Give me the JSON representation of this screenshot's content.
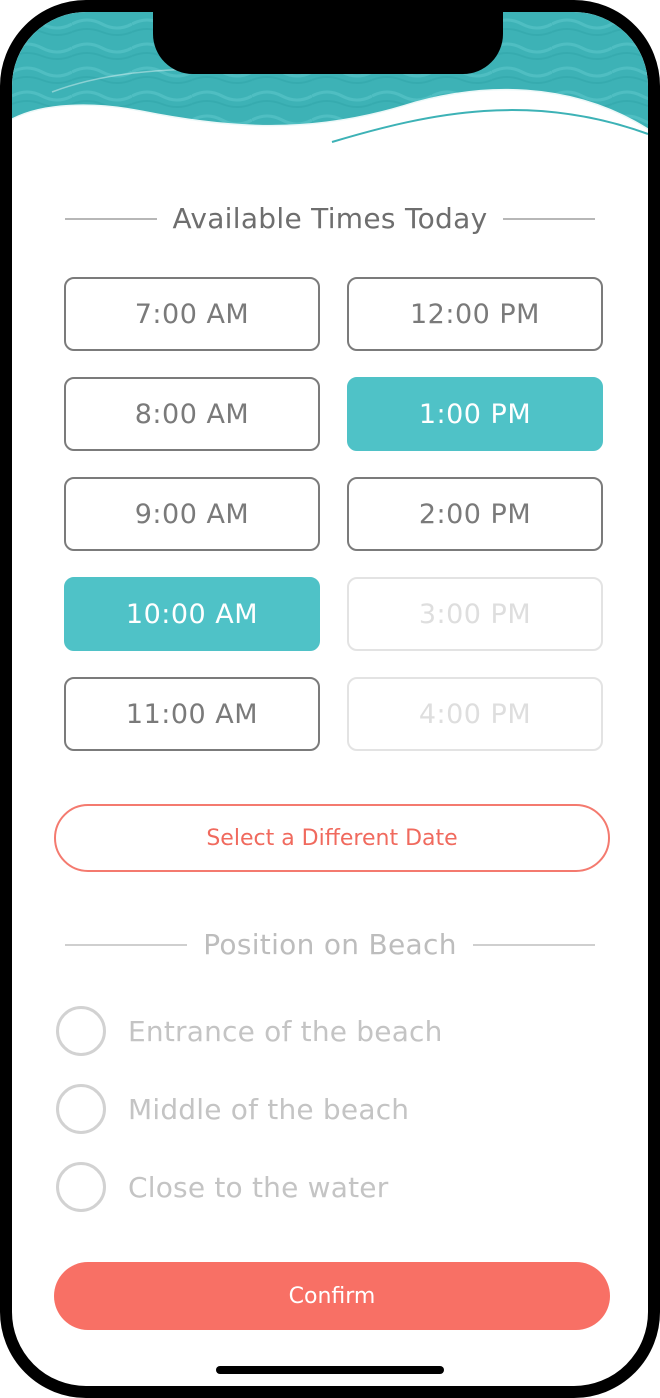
{
  "colors": {
    "accent_teal": "#4fc2c7",
    "accent_coral": "#f87065",
    "header_water": "#3db2b6"
  },
  "times": {
    "title": "Available Times Today",
    "slots": [
      {
        "label": "7:00 AM",
        "state": "available"
      },
      {
        "label": "12:00 PM",
        "state": "available"
      },
      {
        "label": "8:00 AM",
        "state": "available"
      },
      {
        "label": "1:00 PM",
        "state": "selected"
      },
      {
        "label": "9:00 AM",
        "state": "available"
      },
      {
        "label": "2:00 PM",
        "state": "available"
      },
      {
        "label": "10:00 AM",
        "state": "selected"
      },
      {
        "label": "3:00 PM",
        "state": "disabled"
      },
      {
        "label": "11:00 AM",
        "state": "available"
      },
      {
        "label": "4:00 PM",
        "state": "disabled"
      }
    ]
  },
  "date_button": {
    "label": "Select a Different Date"
  },
  "position": {
    "title": "Position on Beach",
    "options": [
      {
        "label": "Entrance of the beach",
        "checked": false
      },
      {
        "label": "Middle of the beach",
        "checked": false
      },
      {
        "label": "Close to the water",
        "checked": false
      }
    ]
  },
  "confirm": {
    "label": "Confirm"
  }
}
